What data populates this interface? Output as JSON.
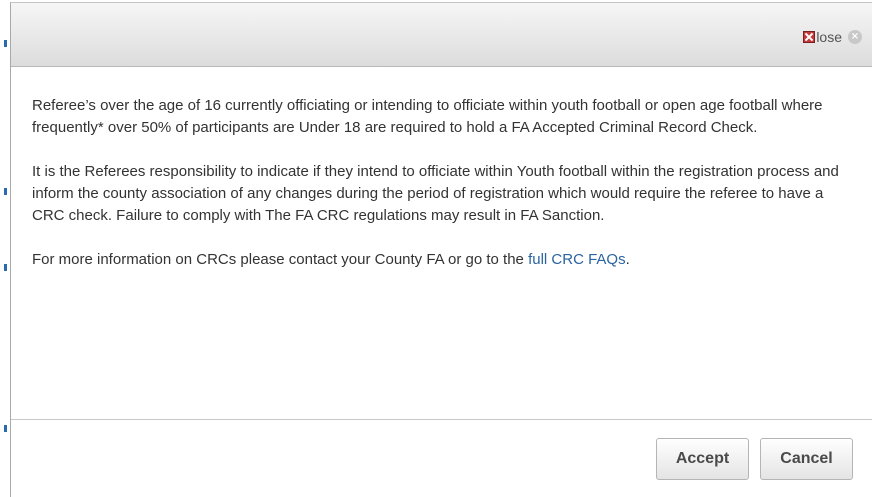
{
  "dialog": {
    "close_label": "lose",
    "close_circle_glyph": "×",
    "paragraphs": [
      "Referee’s over the age of 16 currently officiating or intending to officiate within youth football or open age football where frequently* over 50% of participants are Under 18 are required to hold a FA Accepted Criminal Record Check.",
      "It is the Referees responsibility to indicate if they intend to officiate within Youth football within the registration process and inform the county association of any changes during the period of registration which would require the referee to have a CRC check. Failure to comply with The FA CRC regulations may result in FA Sanction."
    ],
    "info_text": "For more information on CRCs please contact your County FA or go to the ",
    "info_link": "full CRC FAQs",
    "info_end": ".",
    "accept_label": "Accept",
    "cancel_label": "Cancel",
    "link_color": "#2a64a0"
  }
}
